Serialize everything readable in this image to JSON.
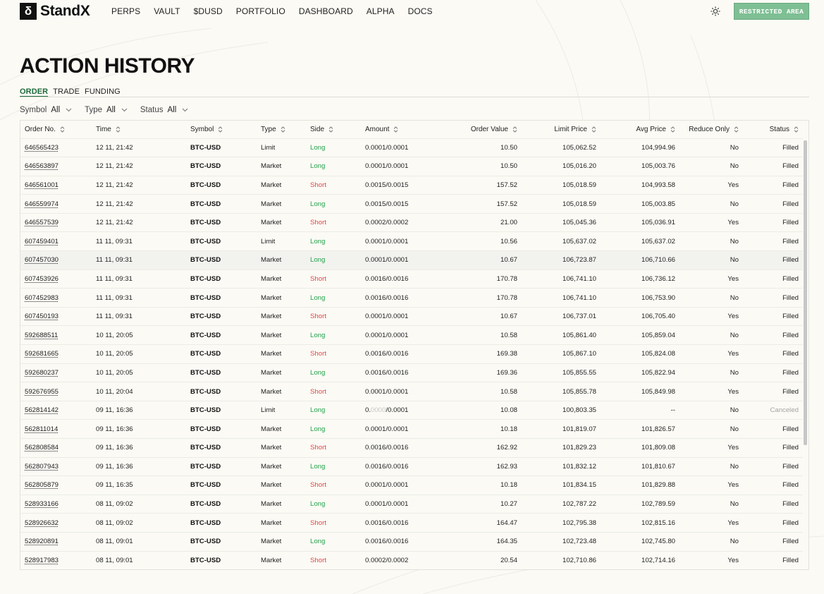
{
  "brand": {
    "logo_glyph": "δ",
    "name": "StandX"
  },
  "nav": {
    "links": [
      "PERPS",
      "VAULT",
      "$DUSD",
      "PORTFOLIO",
      "DASHBOARD",
      "ALPHA",
      "DOCS"
    ]
  },
  "header": {
    "theme_icon": "sun-icon",
    "restricted_label": "RESTRICTED AREA",
    "restricted_color": "#7fbf94"
  },
  "page": {
    "title": "ACTION HISTORY"
  },
  "tabs": [
    {
      "label": "ORDER",
      "active": true
    },
    {
      "label": "TRADE",
      "active": false
    },
    {
      "label": "FUNDING",
      "active": false
    }
  ],
  "filters": [
    {
      "label": "Symbol",
      "value": "All"
    },
    {
      "label": "Type",
      "value": "All"
    },
    {
      "label": "Status",
      "value": "All"
    }
  ],
  "colors": {
    "long": "#21a34a",
    "short": "#e04545",
    "accent": "#1f6b3d"
  },
  "table": {
    "columns": [
      "Order No.",
      "Time",
      "Symbol",
      "Type",
      "Side",
      "Amount",
      "Order Value",
      "Limit Price",
      "Avg Price",
      "Reduce Only",
      "Status"
    ],
    "rows": [
      [
        "646565423",
        "12 11, 21:42",
        "BTC-USD",
        "Limit",
        "Long",
        "0.0001/0.0001",
        "10.50",
        "105,062.52",
        "104,994.96",
        "No",
        "Filled"
      ],
      [
        "646563897",
        "12 11, 21:42",
        "BTC-USD",
        "Market",
        "Long",
        "0.0001/0.0001",
        "10.50",
        "105,016.20",
        "105,003.76",
        "No",
        "Filled"
      ],
      [
        "646561001",
        "12 11, 21:42",
        "BTC-USD",
        "Market",
        "Short",
        "0.0015/0.0015",
        "157.52",
        "105,018.59",
        "104,993.58",
        "Yes",
        "Filled"
      ],
      [
        "646559974",
        "12 11, 21:42",
        "BTC-USD",
        "Market",
        "Long",
        "0.0015/0.0015",
        "157.52",
        "105,018.59",
        "105,003.85",
        "No",
        "Filled"
      ],
      [
        "646557539",
        "12 11, 21:42",
        "BTC-USD",
        "Market",
        "Short",
        "0.0002/0.0002",
        "21.00",
        "105,045.36",
        "105,036.91",
        "Yes",
        "Filled"
      ],
      [
        "607459401",
        "11 11, 09:31",
        "BTC-USD",
        "Limit",
        "Long",
        "0.0001/0.0001",
        "10.56",
        "105,637.02",
        "105,637.02",
        "No",
        "Filled"
      ],
      [
        "607457030",
        "11 11, 09:31",
        "BTC-USD",
        "Market",
        "Long",
        "0.0001/0.0001",
        "10.67",
        "106,723.87",
        "106,710.66",
        "No",
        "Filled"
      ],
      [
        "607453926",
        "11 11, 09:31",
        "BTC-USD",
        "Market",
        "Short",
        "0.0016/0.0016",
        "170.78",
        "106,741.10",
        "106,736.12",
        "Yes",
        "Filled"
      ],
      [
        "607452983",
        "11 11, 09:31",
        "BTC-USD",
        "Market",
        "Long",
        "0.0016/0.0016",
        "170.78",
        "106,741.10",
        "106,753.90",
        "No",
        "Filled"
      ],
      [
        "607450193",
        "11 11, 09:31",
        "BTC-USD",
        "Market",
        "Short",
        "0.0001/0.0001",
        "10.67",
        "106,737.01",
        "106,705.40",
        "Yes",
        "Filled"
      ],
      [
        "592688511",
        "10 11, 20:05",
        "BTC-USD",
        "Market",
        "Long",
        "0.0001/0.0001",
        "10.58",
        "105,861.40",
        "105,859.04",
        "No",
        "Filled"
      ],
      [
        "592681665",
        "10 11, 20:05",
        "BTC-USD",
        "Market",
        "Short",
        "0.0016/0.0016",
        "169.38",
        "105,867.10",
        "105,824.08",
        "Yes",
        "Filled"
      ],
      [
        "592680237",
        "10 11, 20:05",
        "BTC-USD",
        "Market",
        "Long",
        "0.0016/0.0016",
        "169.36",
        "105,855.55",
        "105,822.94",
        "No",
        "Filled"
      ],
      [
        "592676955",
        "10 11, 20:04",
        "BTC-USD",
        "Market",
        "Short",
        "0.0001/0.0001",
        "10.58",
        "105,855.78",
        "105,849.98",
        "Yes",
        "Filled"
      ],
      [
        "562814142",
        "09 11, 16:36",
        "BTC-USD",
        "Limit",
        "Long",
        "0.0000/0.0001",
        "10.08",
        "100,803.35",
        "--",
        "No",
        "Canceled"
      ],
      [
        "562811014",
        "09 11, 16:36",
        "BTC-USD",
        "Market",
        "Long",
        "0.0001/0.0001",
        "10.18",
        "101,819.07",
        "101,826.57",
        "No",
        "Filled"
      ],
      [
        "562808584",
        "09 11, 16:36",
        "BTC-USD",
        "Market",
        "Short",
        "0.0016/0.0016",
        "162.92",
        "101,829.23",
        "101,809.08",
        "Yes",
        "Filled"
      ],
      [
        "562807943",
        "09 11, 16:36",
        "BTC-USD",
        "Market",
        "Long",
        "0.0016/0.0016",
        "162.93",
        "101,832.12",
        "101,810.67",
        "No",
        "Filled"
      ],
      [
        "562805879",
        "09 11, 16:35",
        "BTC-USD",
        "Market",
        "Short",
        "0.0001/0.0001",
        "10.18",
        "101,834.15",
        "101,829.88",
        "Yes",
        "Filled"
      ],
      [
        "528933166",
        "08 11, 09:02",
        "BTC-USD",
        "Market",
        "Long",
        "0.0001/0.0001",
        "10.27",
        "102,787.22",
        "102,789.59",
        "No",
        "Filled"
      ],
      [
        "528926632",
        "08 11, 09:02",
        "BTC-USD",
        "Market",
        "Short",
        "0.0016/0.0016",
        "164.47",
        "102,795.38",
        "102,815.16",
        "Yes",
        "Filled"
      ],
      [
        "528920891",
        "08 11, 09:01",
        "BTC-USD",
        "Market",
        "Long",
        "0.0016/0.0016",
        "164.35",
        "102,723.48",
        "102,745.80",
        "No",
        "Filled"
      ],
      [
        "528917983",
        "08 11, 09:01",
        "BTC-USD",
        "Market",
        "Short",
        "0.0002/0.0002",
        "20.54",
        "102,710.86",
        "102,714.16",
        "Yes",
        "Filled"
      ]
    ]
  }
}
